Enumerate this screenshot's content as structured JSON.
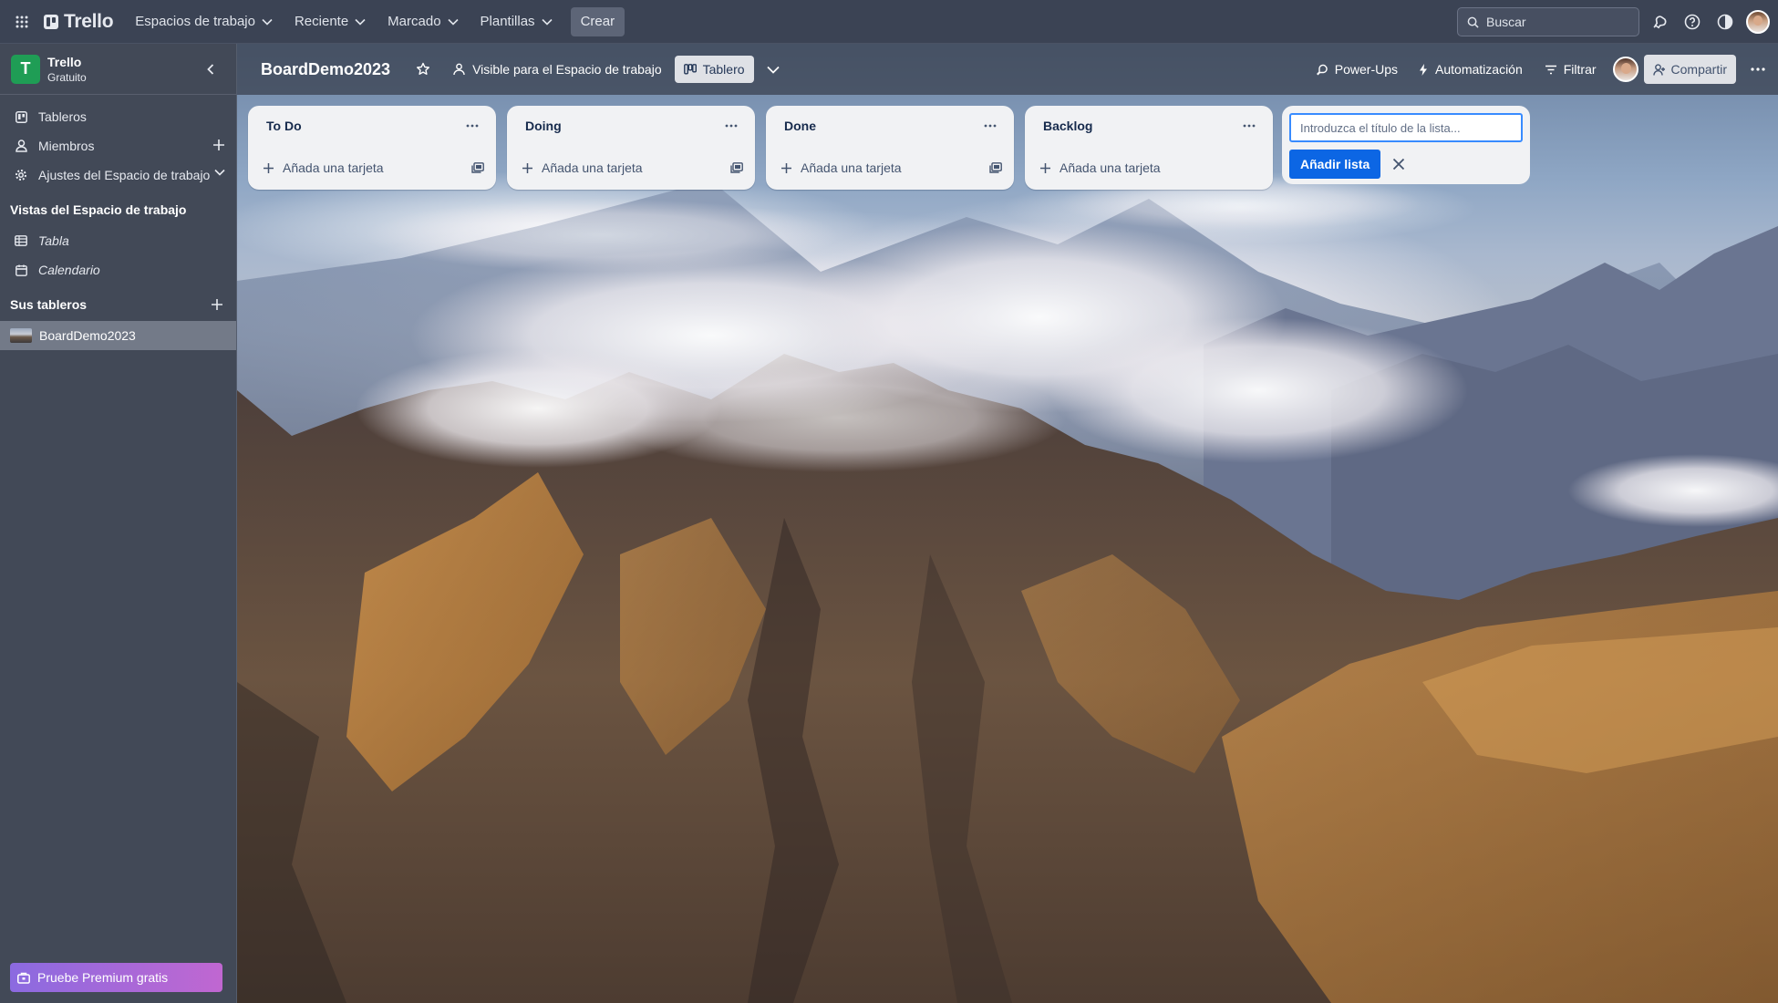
{
  "topnav": {
    "logo": "Trello",
    "menus": [
      "Espacios de trabajo",
      "Reciente",
      "Marcado",
      "Plantillas"
    ],
    "create_label": "Crear",
    "search_placeholder": "Buscar"
  },
  "sidebar": {
    "workspace_initial": "T",
    "workspace_name": "Trello",
    "workspace_plan": "Gratuito",
    "items": [
      {
        "label": "Tableros",
        "icon": "board-icon"
      },
      {
        "label": "Miembros",
        "icon": "person-icon"
      },
      {
        "label": "Ajustes del Espacio de trabajo",
        "icon": "gear-icon"
      }
    ],
    "views_heading": "Vistas del Espacio de trabajo",
    "views": [
      {
        "label": "Tabla",
        "icon": "table-icon"
      },
      {
        "label": "Calendario",
        "icon": "calendar-icon"
      }
    ],
    "boards_heading": "Sus tableros",
    "boards": [
      {
        "label": "BoardDemo2023"
      }
    ],
    "premium_label": "Pruebe Premium gratis"
  },
  "board": {
    "name": "BoardDemo2023",
    "visibility": "Visible para el Espacio de trabajo",
    "view_label": "Tablero",
    "powerups": "Power-Ups",
    "automation": "Automatización",
    "filter": "Filtrar",
    "share": "Compartir"
  },
  "lists": [
    {
      "title": "To Do",
      "add_card": "Añada una tarjeta"
    },
    {
      "title": "Doing",
      "add_card": "Añada una tarjeta"
    },
    {
      "title": "Done",
      "add_card": "Añada una tarjeta"
    },
    {
      "title": "Backlog",
      "add_card": "Añada una tarjeta"
    }
  ],
  "add_list": {
    "placeholder": "Introduzca el título de la lista...",
    "button": "Añadir lista"
  },
  "colors": {
    "accent": "#0c66e4",
    "topbar": "#3b4354",
    "list_bg": "#f1f2f4"
  }
}
